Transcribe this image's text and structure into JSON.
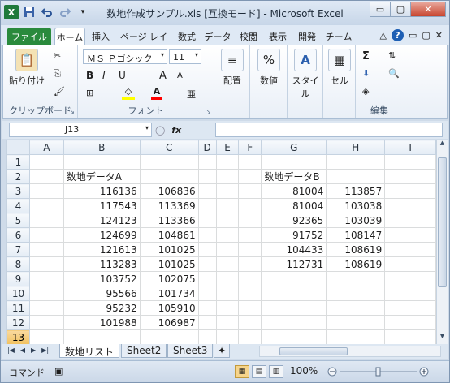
{
  "window": {
    "title": "数地作成サンプル.xls  [互換モード]  -  Microsoft Excel",
    "app_icon": "X",
    "qat": [
      "save-icon",
      "undo-icon",
      "redo-icon",
      "customize-icon"
    ],
    "buttons": [
      "minimize",
      "maximize",
      "close"
    ],
    "button_glyphs": [
      "▭",
      "▢",
      "✕"
    ]
  },
  "ribbon_tabs": [
    "ファイル",
    "ホーム",
    "挿入",
    "ページ レイ",
    "数式",
    "データ",
    "校閲",
    "表示",
    "開発",
    "チーム"
  ],
  "ribbon": {
    "clipboard": {
      "paste": "貼り付け",
      "label": "クリップボード"
    },
    "font": {
      "name": "ＭＳ Ｐゴシック",
      "size": "11",
      "bold": "B",
      "italic": "I",
      "underline": "U",
      "grow": "A",
      "shrink": "A",
      "label": "フォント",
      "fill_color": "#ffff00",
      "font_color": "#ff0000"
    },
    "align": {
      "label": "配置"
    },
    "number": {
      "label": "数値",
      "symbol": "%"
    },
    "style": {
      "label": "スタイル"
    },
    "cells": {
      "label": "セル"
    },
    "edit": {
      "label": "編集",
      "sum": "Σ"
    }
  },
  "formula_bar": {
    "name_box": "J13",
    "fx": "fx",
    "value": ""
  },
  "grid": {
    "columns": [
      "",
      "A",
      "B",
      "C",
      "D",
      "E",
      "F",
      "G",
      "H",
      "I"
    ],
    "selected_row": "13",
    "rows": [
      {
        "n": "1",
        "B": "",
        "C": "",
        "G": "",
        "H": ""
      },
      {
        "n": "2",
        "B": "数地データA",
        "C": "",
        "G": "数地データB",
        "H": ""
      },
      {
        "n": "3",
        "B": "116136",
        "C": "106836",
        "G": "81004",
        "H": "113857"
      },
      {
        "n": "4",
        "B": "117543",
        "C": "113369",
        "G": "81004",
        "H": "103038"
      },
      {
        "n": "5",
        "B": "124123",
        "C": "113366",
        "G": "92365",
        "H": "103039"
      },
      {
        "n": "6",
        "B": "124699",
        "C": "104861",
        "G": "91752",
        "H": "108147"
      },
      {
        "n": "7",
        "B": "121613",
        "C": "101025",
        "G": "104433",
        "H": "108619"
      },
      {
        "n": "8",
        "B": "113283",
        "C": "101025",
        "G": "112731",
        "H": "108619"
      },
      {
        "n": "9",
        "B": "103752",
        "C": "102075",
        "G": "",
        "H": ""
      },
      {
        "n": "10",
        "B": "95566",
        "C": "101734",
        "G": "",
        "H": ""
      },
      {
        "n": "11",
        "B": "95232",
        "C": "105910",
        "G": "",
        "H": ""
      },
      {
        "n": "12",
        "B": "101988",
        "C": "106987",
        "G": "",
        "H": ""
      },
      {
        "n": "13",
        "B": "",
        "C": "",
        "G": "",
        "H": ""
      }
    ]
  },
  "sheet_tabs": [
    "数地リスト",
    "Sheet2",
    "Sheet3"
  ],
  "active_sheet": "数地リスト",
  "status": {
    "mode": "コマンド",
    "zoom": "100%",
    "minus": "－",
    "plus": "＋"
  },
  "colors": {
    "file_tab": "#2a8a3c",
    "selected_header": "#f1c15f",
    "close_button": "#c7452f"
  }
}
